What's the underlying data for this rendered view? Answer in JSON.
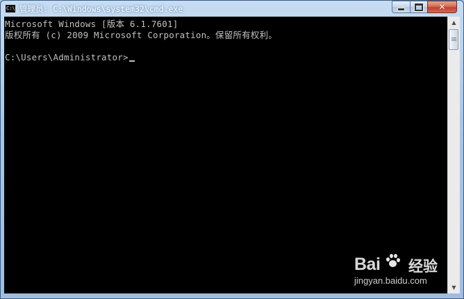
{
  "window": {
    "title": "管理员: C:\\Windows\\system32\\cmd.exe",
    "icon_label": "C:\\"
  },
  "console": {
    "lines": [
      "Microsoft Windows [版本 6.1.7601]",
      "版权所有 (c) 2009 Microsoft Corporation。保留所有权利。",
      "",
      "C:\\Users\\Administrator>"
    ]
  },
  "scrollbar": {
    "up_arrow": "▲",
    "down_arrow": "▼"
  },
  "watermark": {
    "logo_text": "Bai",
    "logo_suffix": "经验",
    "url": "jingyan.baidu.com"
  },
  "colors": {
    "console_background": "#000000",
    "console_text": "#c0c0c0",
    "close_button": "#c2412b"
  },
  "icons": {
    "app": "cmd-icon",
    "minimize": "minimize-icon",
    "maximize": "maximize-icon",
    "close": "close-icon"
  }
}
